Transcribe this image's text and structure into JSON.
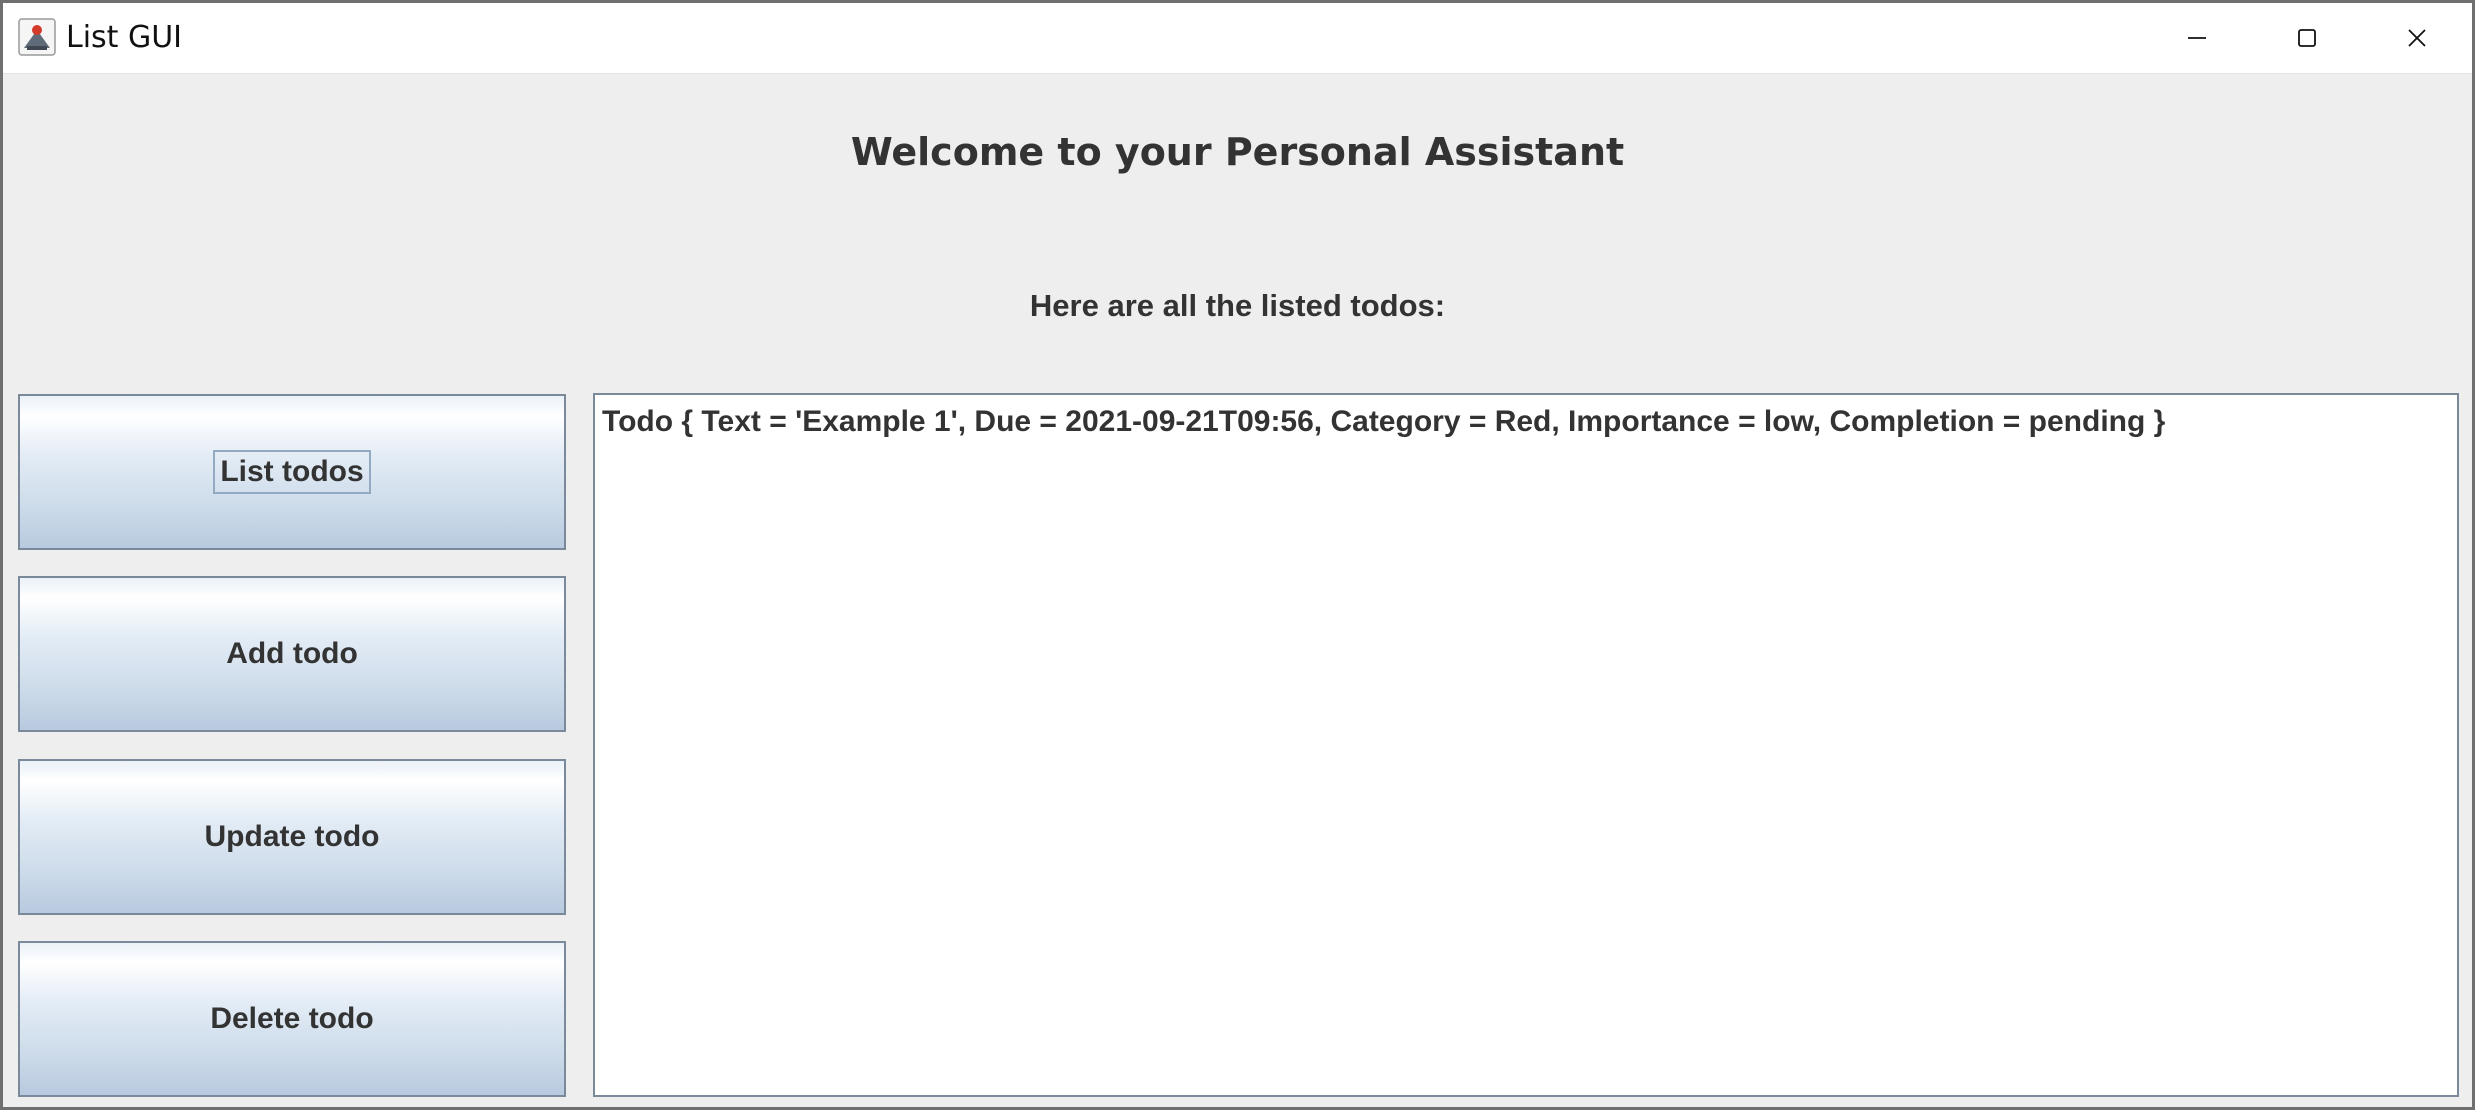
{
  "window": {
    "title": "List GUI",
    "icons": {
      "app": "java-app-icon",
      "minimize": "minimize-icon",
      "maximize": "maximize-icon",
      "close": "close-icon"
    }
  },
  "main": {
    "heading": "Welcome to your Personal Assistant",
    "subheading": "Here are all the listed todos:"
  },
  "buttons": {
    "list": "List todos",
    "add": "Add todo",
    "update": "Update todo",
    "delete": "Delete todo"
  },
  "todos": [
    "Todo { Text = 'Example 1', Due = 2021-09-21T09:56, Category = Red, Importance = low, Completion = pending }"
  ],
  "colors": {
    "window_bg": "#eeeeee",
    "button_gradient_top": "#ffffff",
    "button_gradient_bottom": "#b8cadf",
    "button_border": "#7a8a9a",
    "text": "#333333"
  }
}
